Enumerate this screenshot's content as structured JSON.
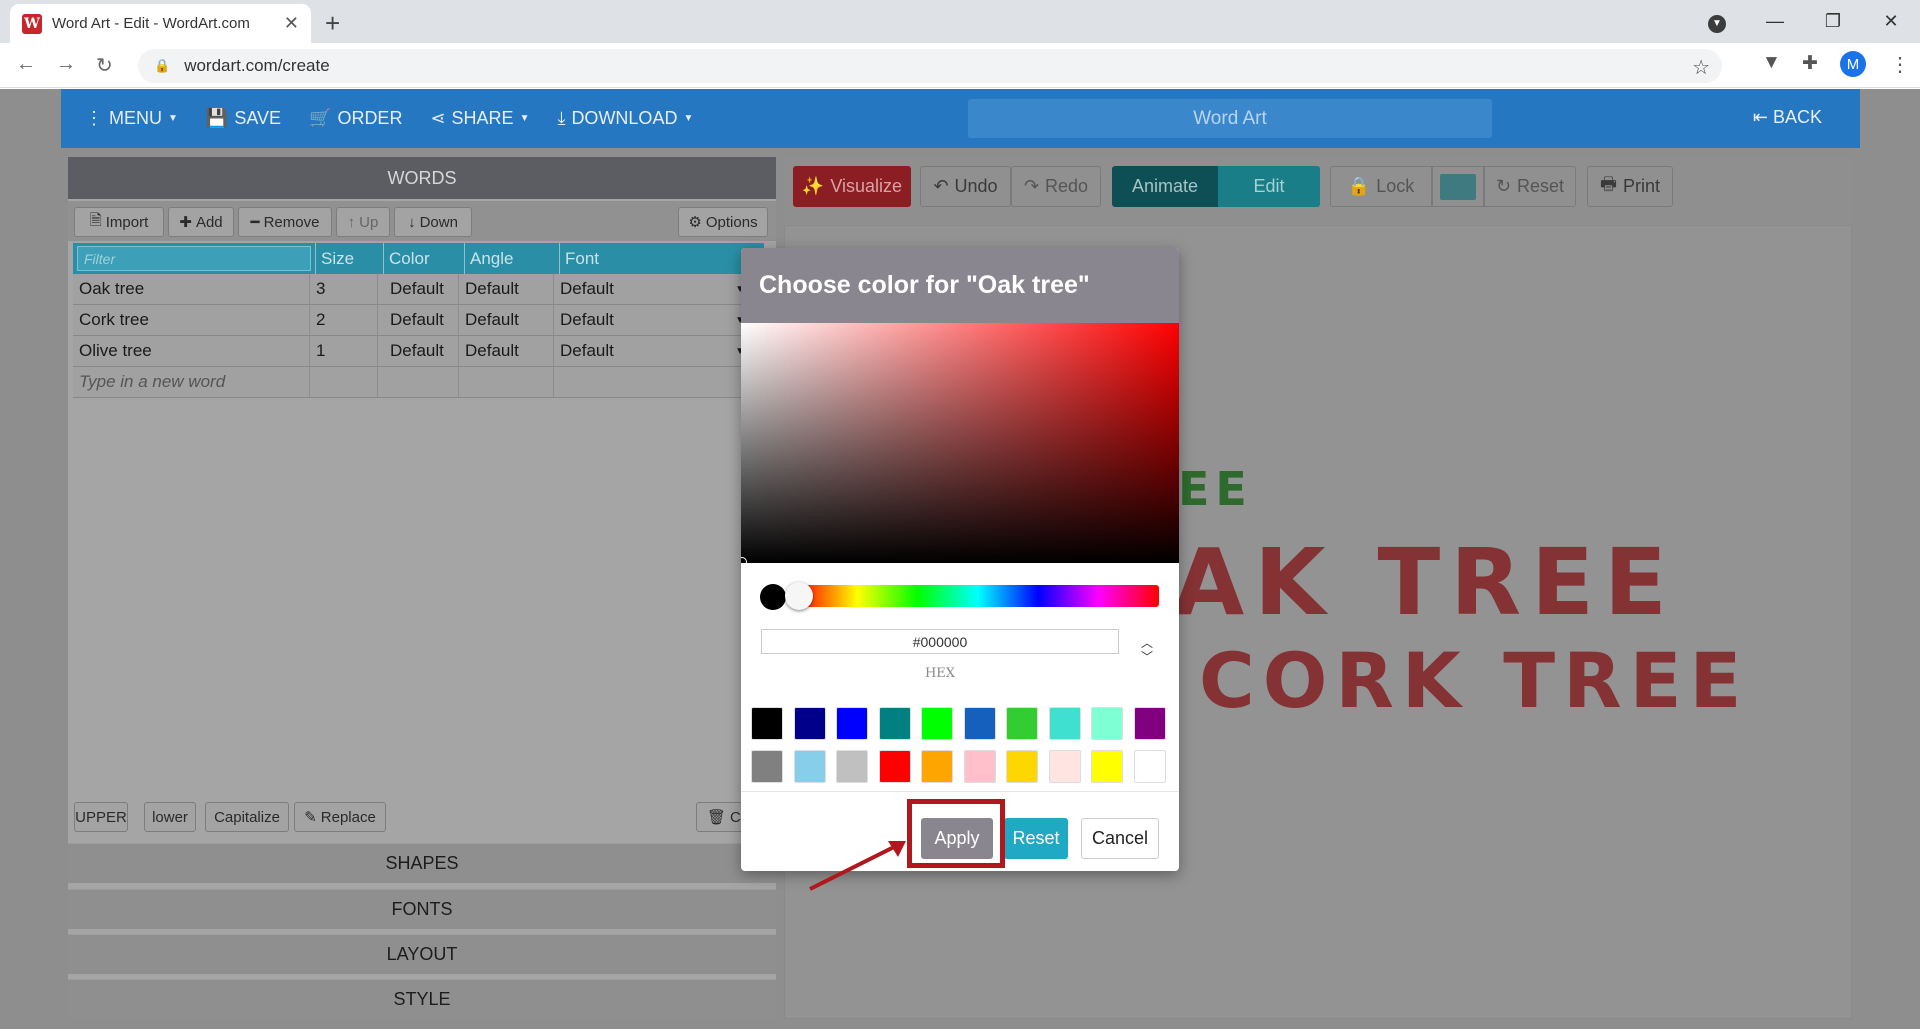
{
  "browser": {
    "tab_title": "Word Art - Edit - WordArt.com",
    "tab_close": "✕",
    "favicon_letter": "W",
    "url": "wordart.com/create",
    "avatar_letter": "M"
  },
  "header": {
    "menu": "MENU",
    "save": "SAVE",
    "order": "ORDER",
    "share": "SHARE",
    "download": "DOWNLOAD",
    "title": "Word Art",
    "back": "BACK"
  },
  "words_panel": {
    "title": "WORDS",
    "toolbar": {
      "import": "Import",
      "add": "Add",
      "remove": "Remove",
      "up": "Up",
      "down": "Down",
      "options": "Options"
    },
    "columns": {
      "filter_placeholder": "Filter",
      "size": "Size",
      "color": "Color",
      "angle": "Angle",
      "font": "Font"
    },
    "rows": [
      {
        "word": "Oak tree",
        "size": "3",
        "color": "Default",
        "angle": "Default",
        "font": "Default"
      },
      {
        "word": "Cork tree",
        "size": "2",
        "color": "Default",
        "angle": "Default",
        "font": "Default"
      },
      {
        "word": "Olive tree",
        "size": "1",
        "color": "Default",
        "angle": "Default",
        "font": "Default"
      }
    ],
    "new_word_placeholder": "Type in a new word",
    "case_buttons": {
      "upper": "UPPER",
      "lower": "lower",
      "capitalize": "Capitalize",
      "replace": "Replace",
      "clear": "Cl"
    }
  },
  "sections": [
    "SHAPES",
    "FONTS",
    "LAYOUT",
    "STYLE"
  ],
  "canvas_toolbar": {
    "visualize": "Visualize",
    "undo": "Undo",
    "redo": "Redo",
    "animate": "Animate",
    "edit": "Edit",
    "lock": "Lock",
    "reset": "Reset",
    "print": "Print"
  },
  "canvas_words": {
    "olive_fragment": "EE",
    "oak": "AK TREE",
    "cork": "CORK TREE"
  },
  "color_dialog": {
    "title": "Choose color for \"Oak tree\"",
    "hex_value": "#000000",
    "hex_label": "HEX",
    "swatches": [
      "#000000",
      "#00008b",
      "#0000ff",
      "#008080",
      "#00ff00",
      "#1560bd",
      "#32cd32",
      "#40e0d0",
      "#7fffd4",
      "#800080",
      "#808080",
      "#87ceeb",
      "#c0c0c0",
      "#ff0000",
      "#ffa500",
      "#ffc0cb",
      "#ffd700",
      "#ffe4e1",
      "#ffff00",
      "#ffffff"
    ],
    "apply": "Apply",
    "reset": "Reset",
    "cancel": "Cancel"
  },
  "colors": {
    "header_blue": "#2677c2",
    "grid_teal": "#2a8fa6",
    "annotation_red": "#b0181e"
  }
}
